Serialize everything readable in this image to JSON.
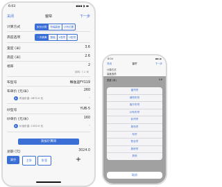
{
  "phone1": {
    "status": {
      "time": "6:03",
      "signal": "▪▪▪ ◗ ▬"
    },
    "nav": {
      "left": "关闭",
      "title": "窗帘",
      "right": "下一步"
    },
    "calc_mode": {
      "label": "计算方式",
      "options": [
        "米价计算",
        "布幅高度",
        "计布位置"
      ],
      "selected": 0
    },
    "height_option": {
      "label": "高度选项",
      "options": [
        "一次铺满",
        "整幅",
        "U型帘",
        "U型帘"
      ],
      "selected": 0
    },
    "width": {
      "label": "宽度 (米)",
      "value": "3.6"
    },
    "height": {
      "label": "高度 (米)",
      "value": "2.6"
    },
    "fold": {
      "label": "褶率",
      "value": "2"
    },
    "fold_note": "用料: 7.2 米",
    "cloth_model": {
      "label": "布型号",
      "value": "臻逸蓝FY119"
    },
    "cloth_price": {
      "label": "布单价 (元/米)",
      "value": "260"
    },
    "cloth_note": "布出价金: 1872.0 元",
    "yarn_model": {
      "label": "纱型号",
      "value": "YUB-5"
    },
    "yarn_price": {
      "label": "纱单价 (元/米)",
      "value": "160"
    },
    "yarn_note": "纱出价金: 1152.0 元",
    "add_calc": "添加计算目",
    "total": {
      "label": "总额 (元)",
      "value": "3024.0"
    },
    "buttons": {
      "clear": "清空",
      "main": "主卧",
      "secondary": "卧室",
      "plus": "+"
    }
  },
  "phone2": {
    "status": {
      "time": "6:04",
      "signal": "▪▪ ▬"
    },
    "nav": {
      "left": "关闭",
      "title": "窗帘",
      "right": "下一步"
    },
    "calc_mode_label": "计算方式",
    "height_option_label": "高度选项",
    "width_label": "宽度 (米)",
    "width_value": "3.6",
    "sheet_options": [
      "窗帘帘",
      "铺帘布帘",
      "客厅布帘",
      "纱布布帘",
      "卧帘帘",
      "厨布帘",
      "布帘",
      "阳台帘",
      "厨房帘",
      "其他"
    ],
    "cancel": "取消"
  },
  "colors": {
    "accent": "#3b6fd6"
  }
}
